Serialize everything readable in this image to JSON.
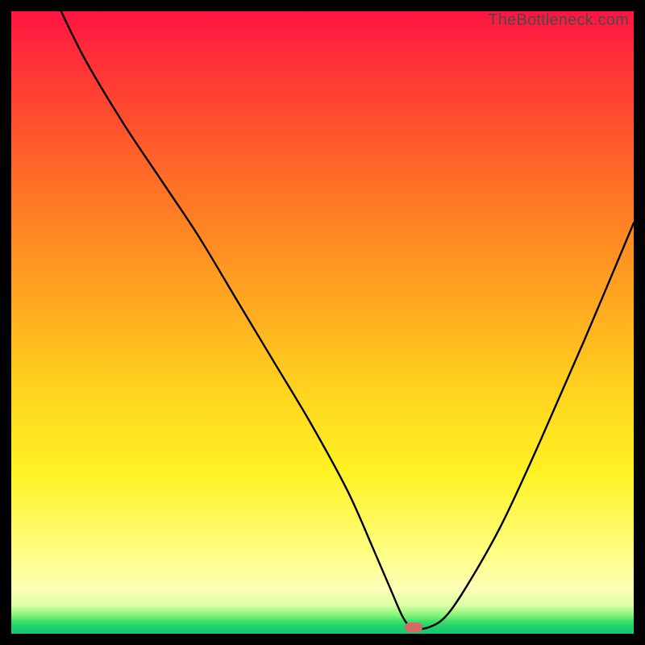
{
  "attribution": "TheBottleneck.com",
  "gradient_colors": {
    "top": "#ff1342",
    "mid_orange": "#ff8e22",
    "mid_yellow": "#fff223",
    "pale": "#fcffb8",
    "green": "#18c66e"
  },
  "marker_color": "#d86a66",
  "chart_data": {
    "type": "line",
    "title": "",
    "xlabel": "",
    "ylabel": "",
    "xlim": [
      0,
      100
    ],
    "ylim": [
      0,
      100
    ],
    "series": [
      {
        "name": "curve",
        "x": [
          8,
          12,
          18,
          24,
          30,
          36,
          42,
          48,
          54,
          58,
          61,
          63,
          64.5,
          67,
          70,
          74,
          79,
          85,
          92,
          100
        ],
        "values": [
          100,
          92,
          82,
          73,
          64,
          54,
          44,
          34,
          23,
          14,
          7,
          2.5,
          1,
          1,
          3,
          9,
          18,
          31,
          47,
          66
        ]
      }
    ],
    "marker": {
      "x": 64.7,
      "y": 1,
      "shape": "pill",
      "color": "#d86a66"
    }
  }
}
